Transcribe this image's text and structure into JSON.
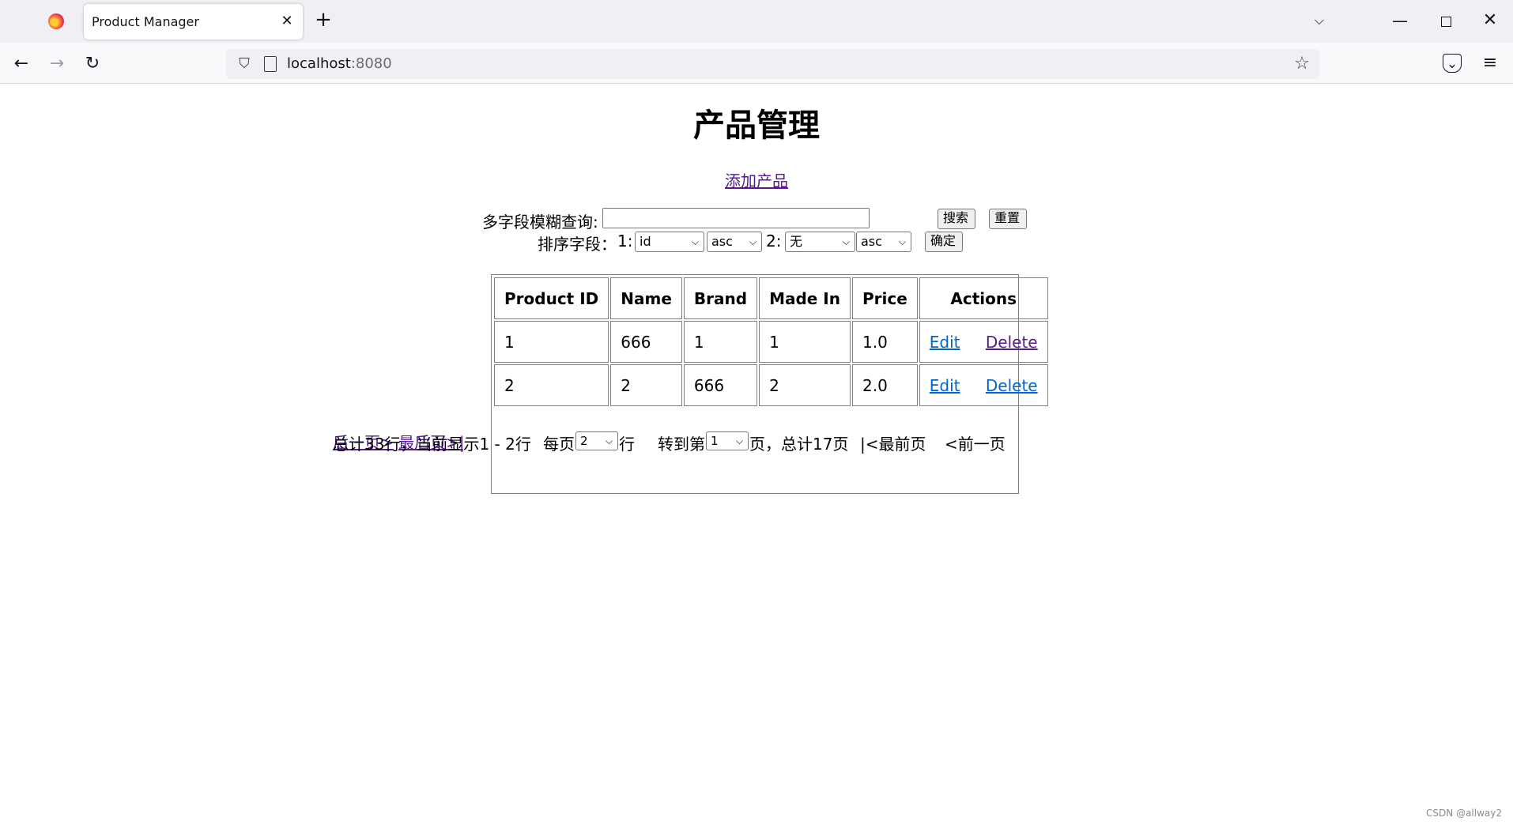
{
  "browser": {
    "tab_title": "Product Manager",
    "tab_close": "✕",
    "new_tab": "+",
    "url_host": "localhost",
    "url_port": ":8080"
  },
  "page": {
    "title": "产品管理",
    "add_link": "添加产品"
  },
  "search": {
    "label": "多字段模糊查询:",
    "value": "",
    "search_button": "搜索",
    "reset_button": "重置"
  },
  "sort": {
    "label": "排序字段：",
    "field1_label": "1:",
    "field1_value": "id",
    "order1_value": "asc",
    "field2_label": "2:",
    "field2_value": "无",
    "order2_value": "asc",
    "confirm_button": "确定"
  },
  "table": {
    "headers": [
      "Product ID",
      "Name",
      "Brand",
      "Made In",
      "Price",
      "Actions"
    ],
    "rows": [
      {
        "id": "1",
        "name": "666",
        "brand": "1",
        "made_in": "1",
        "price": "1.0"
      },
      {
        "id": "2",
        "name": "2",
        "brand": "666",
        "made_in": "2",
        "price": "2.0"
      }
    ],
    "edit_label": "Edit",
    "delete_label": "Delete"
  },
  "pager": {
    "summary": "总计33行，当前显示1 - 2行",
    "per_page_label": "每页",
    "per_page_value": "2",
    "per_page_suffix": "行",
    "goto_label": "转到第",
    "goto_value": "1",
    "goto_suffix": "页，总计17页",
    "first": "|<最前页",
    "prev": "<前一页",
    "next": "后一页>",
    "last": "最后页>|"
  },
  "watermark": "CSDN @allway2"
}
